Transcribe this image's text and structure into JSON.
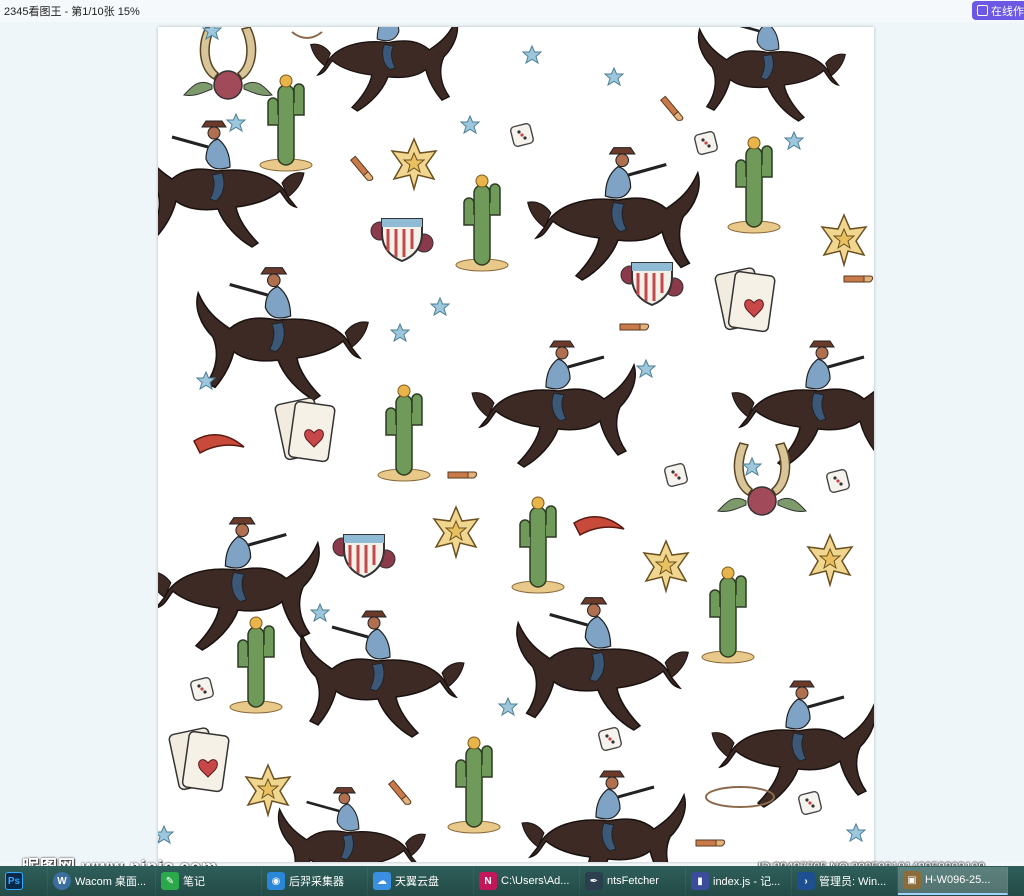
{
  "window": {
    "title": "2345看图王 - 第1/10张 15%",
    "online_button": "在线作"
  },
  "watermark": {
    "site": "昵图网 www.nipic.com",
    "id_text": "ID:28437705 NO:20250310142950303109"
  },
  "taskbar": {
    "items": [
      {
        "label": "",
        "icon": "photoshop-icon",
        "color": "#0b2a4a",
        "glyph": "Ps"
      },
      {
        "label": "Wacom 桌面...",
        "icon": "wacom-icon",
        "color": "#3a6f9f",
        "glyph": "W"
      },
      {
        "label": "笔记",
        "icon": "notes-icon",
        "color": "#2aa84a",
        "glyph": "✎"
      },
      {
        "label": "后羿采集器",
        "icon": "collector-icon",
        "color": "#2a86d6",
        "glyph": "◉"
      },
      {
        "label": "天翼云盘",
        "icon": "cloud-drive-icon",
        "color": "#3b8fe0",
        "glyph": "☁"
      },
      {
        "label": "C:\\Users\\Ad...",
        "icon": "terminal-icon",
        "color": "#c2185b",
        "glyph": "N"
      },
      {
        "label": "ntsFetcher",
        "icon": "feather-icon",
        "color": "#2b3f4f",
        "glyph": "✒"
      },
      {
        "label": "index.js - 记...",
        "icon": "editor-icon",
        "color": "#3a4d9a",
        "glyph": "▮"
      },
      {
        "label": "管理员: Win...",
        "icon": "powershell-icon",
        "color": "#1d4f91",
        "glyph": "›"
      },
      {
        "label": "H-W096-25...",
        "icon": "image-viewer-icon",
        "color": "#8a6d3b",
        "glyph": "▣"
      }
    ]
  },
  "colors": {
    "viewer_bg": "#eef6fa",
    "taskbar": "#2a5652",
    "accent_button": "#6d58e6"
  }
}
